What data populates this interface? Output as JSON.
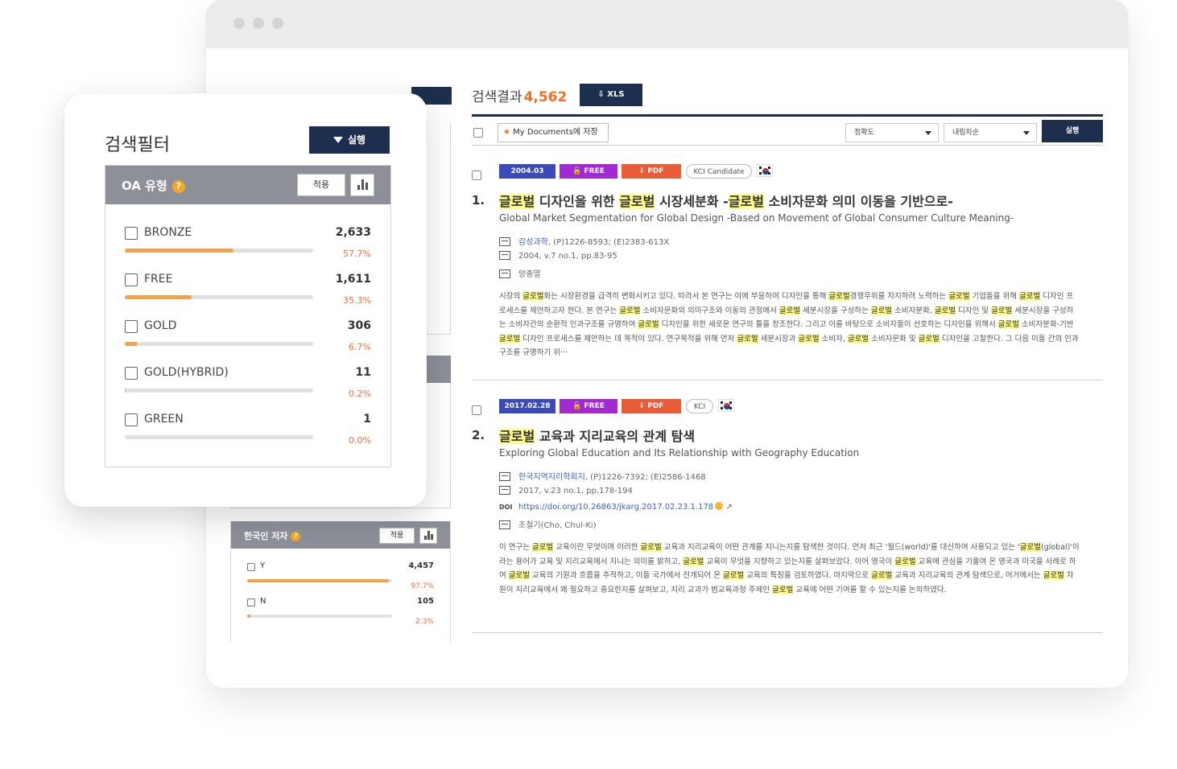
{
  "search_filter": {
    "title": "검색필터",
    "apply_button": "실행",
    "oa_panel": {
      "title": "OA 유형",
      "help": "?",
      "apply_label": "적용",
      "items": [
        {
          "label": "BRONZE",
          "count": "2,633",
          "percent": "57.7%",
          "fill": 0.577
        },
        {
          "label": "FREE",
          "count": "1,611",
          "percent": "35.3%",
          "fill": 0.353
        },
        {
          "label": "GOLD",
          "count": "306",
          "percent": "6.7%",
          "fill": 0.067
        },
        {
          "label": "GOLD(HYBRID)",
          "count": "11",
          "percent": "0.2%",
          "fill": 0.002
        },
        {
          "label": "GREEN",
          "count": "1",
          "percent": "0.0%",
          "fill": 0.0
        }
      ]
    }
  },
  "korean_author_panel": {
    "title": "한국인 저자",
    "help": "?",
    "apply_label": "적용",
    "items": [
      {
        "label": "Y",
        "count": "4,457",
        "percent": "97.7%",
        "fill": 0.977
      },
      {
        "label": "N",
        "count": "105",
        "percent": "2.3%",
        "fill": 0.023
      }
    ]
  },
  "results": {
    "label": "검색결과",
    "count": "4,562",
    "xls_button": "XLS",
    "my_documents_button": "My Documents에 저장",
    "sort_select": "정확도",
    "order_select": "내림차순",
    "sort_button": "실행",
    "items": [
      {
        "number": "1.",
        "date": "2004.03",
        "free": "FREE",
        "pdf": "PDF",
        "kci": "KCI Candidate",
        "title_parts": [
          {
            "t": "글로벌",
            "h": true
          },
          {
            "t": " 디자인을 위한 ",
            "h": false
          },
          {
            "t": "글로벌",
            "h": true
          },
          {
            "t": " 시장세분화 -",
            "h": false
          },
          {
            "t": "글로벌",
            "h": true
          },
          {
            "t": " 소비자문화 의미 이동을 기반으로-",
            "h": false
          }
        ],
        "title_en": "Global Market Segmentation for Global Design -Based on Movement of Global Consumer Culture Meaning-",
        "journal": "감성과학",
        "issn": ", (P)1226-8593; (E)2383-613X",
        "volume": "2004, v.7 no.1, pp.83-95",
        "author": "양종열",
        "abstract_parts": [
          {
            "t": "시장의 ",
            "h": false
          },
          {
            "t": "글로벌",
            "h": true
          },
          {
            "t": "화는 시장환경을 급격히 변화시키고 있다. 따라서 본 연구는 이에 부응하여 디자인을 통해 ",
            "h": false
          },
          {
            "t": "글로벌",
            "h": true
          },
          {
            "t": "경쟁우위를 차지하려 노력하는 ",
            "h": false
          },
          {
            "t": "글로벌",
            "h": true
          },
          {
            "t": " 기업들을 위해 ",
            "h": false
          },
          {
            "t": "글로벌",
            "h": true
          },
          {
            "t": " 디자인 프로세스를 제안하고자 한다. 본 연구는 ",
            "h": false
          },
          {
            "t": "글로벌",
            "h": true
          },
          {
            "t": " 소비자문화의 의미구조와 이동의 관점에서 ",
            "h": false
          },
          {
            "t": "글로벌",
            "h": true
          },
          {
            "t": " 세분시장을 구성하는 ",
            "h": false
          },
          {
            "t": "글로벌",
            "h": true
          },
          {
            "t": " 소비자분화, ",
            "h": false
          },
          {
            "t": "글로벌",
            "h": true
          },
          {
            "t": " 디자인 및 ",
            "h": false
          },
          {
            "t": "글로벌",
            "h": true
          },
          {
            "t": " 세분시장을 구성하는 소비자간의 순환적 인과구조를 규명하여 ",
            "h": false
          },
          {
            "t": "글로벌",
            "h": true
          },
          {
            "t": " 디자인을 위한 새로운 연구의 틀을 창조한다. 그리고 이를 바탕으로 소비자들이 선호하는 디자인을 위해서 ",
            "h": false
          },
          {
            "t": "글로벌",
            "h": true
          },
          {
            "t": " 소비자분화-기반 ",
            "h": false
          },
          {
            "t": "글로벌",
            "h": true
          },
          {
            "t": " 디자인 프로세스를 제안하는 데 목적이 있다. 연구목적을 위해 먼저 ",
            "h": false
          },
          {
            "t": "글로벌",
            "h": true
          },
          {
            "t": " 세분시장과 ",
            "h": false
          },
          {
            "t": "글로벌",
            "h": true
          },
          {
            "t": " 소비자, ",
            "h": false
          },
          {
            "t": "글로벌",
            "h": true
          },
          {
            "t": " 소비자문화 및 ",
            "h": false
          },
          {
            "t": "글로벌",
            "h": true
          },
          {
            "t": " 디자인을 고찰한다. 그 다음 이들 간의 인과구조를 규명하기 위···",
            "h": false
          }
        ]
      },
      {
        "number": "2.",
        "date": "2017.02.28",
        "free": "FREE",
        "pdf": "PDF",
        "kci": "KCI",
        "title_parts": [
          {
            "t": "글로벌",
            "h": true
          },
          {
            "t": " 교육과 지리교육의 관계 탐색",
            "h": false
          }
        ],
        "title_en": "Exploring Global Education and Its Relationship with Geography Education",
        "journal": "한국지역지리학회지",
        "issn": ", (P)1226-7392; (E)2586-1468",
        "volume": "2017, v.23 no.1, pp.178-194",
        "doi_label": "DOI",
        "doi": "https://doi.org/10.26863/jkarg.2017.02.23.1.178",
        "author": "조철기(Cho, Chul-Ki)",
        "abstract_parts": [
          {
            "t": "이 연구는 ",
            "h": false
          },
          {
            "t": "글로벌",
            "h": true
          },
          {
            "t": " 교육이란 무엇이며 이러한 ",
            "h": false
          },
          {
            "t": "글로벌",
            "h": true
          },
          {
            "t": " 교육과 지리교육이 어떤 관계를 지니는지를 탐색한 것이다. 먼저 최근 '월드(world)'를 대신하여 사용되고 있는 '",
            "h": false
          },
          {
            "t": "글로벌",
            "h": true
          },
          {
            "t": "(global)'이라는 용어가 교육 및 지리교육에서 지니는 의미를 밝히고, ",
            "h": false
          },
          {
            "t": "글로벌",
            "h": true
          },
          {
            "t": " 교육이 무엇을 지향하고 있는지를 살펴보았다. 이어 영국이 ",
            "h": false
          },
          {
            "t": "글로벌",
            "h": true
          },
          {
            "t": " 교육에 관심을 기울여 온 영국과 미국을 사례로 하여 ",
            "h": false
          },
          {
            "t": "글로벌",
            "h": true
          },
          {
            "t": " 교육의 기원과 흐름을 추적하고, 이들 국가에서 전개되어 온 ",
            "h": false
          },
          {
            "t": "글로벌",
            "h": true
          },
          {
            "t": " 교육의 특징을 검토하였다. 마지막으로 ",
            "h": false
          },
          {
            "t": "글로벌",
            "h": true
          },
          {
            "t": " 교육과 지리교육의 관계 탐색으로, 어거에서는 ",
            "h": false
          },
          {
            "t": "글로벌",
            "h": true
          },
          {
            "t": " 차원이 지리교육에서 왜 필요하고 중요한지를 살펴보고, 지리 교과가 범교육과정 주제인 ",
            "h": false
          },
          {
            "t": "글로벌",
            "h": true
          },
          {
            "t": " 교육에 어떤 기여를 할 수 있는지를 논의하였다.",
            "h": false
          }
        ]
      }
    ]
  },
  "colors": {
    "navy": "#1e2e4f",
    "orange": "#f26f21",
    "highlight": "#fffb8a",
    "date_badge": "#3a4bb8",
    "free_badge": "#a32ad2",
    "pdf_badge": "#e85c38",
    "panel_header": "#8d8f99",
    "bar_fill": "#f7a04a"
  },
  "icons": {
    "filter_button": "funnel-icon",
    "xls_button": "download-icon",
    "my_documents": "star-icon",
    "chart_toggle": "bar-chart-icon",
    "journal": "journal-icon",
    "volume": "calendar-icon",
    "author": "author-icon",
    "flag": "korea-flag-icon"
  }
}
